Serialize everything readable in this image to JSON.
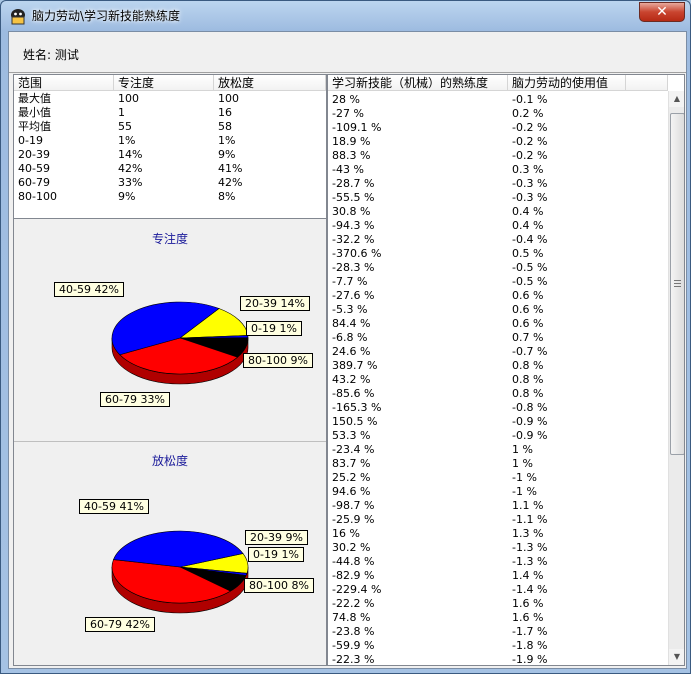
{
  "window": {
    "title": "脑力劳动\\学习新技能熟练度",
    "close": "✕"
  },
  "name_label": "姓名: 测试",
  "stats": {
    "headers": [
      "范围",
      "专注度",
      "放松度"
    ],
    "rows": [
      [
        "最大值",
        "100",
        "100"
      ],
      [
        "最小值",
        "1",
        "16"
      ],
      [
        "平均值",
        "55",
        "58"
      ],
      [
        "0-19",
        "1%",
        "1%"
      ],
      [
        "20-39",
        "14%",
        "9%"
      ],
      [
        "40-59",
        "42%",
        "41%"
      ],
      [
        "60-79",
        "33%",
        "42%"
      ],
      [
        "80-100",
        "9%",
        "8%"
      ]
    ]
  },
  "chart_data": [
    {
      "type": "pie",
      "title": "专注度",
      "slices": [
        {
          "label": "0-19",
          "value": 1,
          "text": "0-19  1%",
          "color": "#0000ff"
        },
        {
          "label": "20-39",
          "value": 14,
          "text": "20-39  14%",
          "color": "#ffff00"
        },
        {
          "label": "40-59",
          "value": 42,
          "text": "40-59  42%",
          "color": "#0000ff"
        },
        {
          "label": "60-79",
          "value": 33,
          "text": "60-79  33%",
          "color": "#ff0000"
        },
        {
          "label": "80-100",
          "value": 9,
          "text": "80-100  9%",
          "color": "#000000"
        }
      ]
    },
    {
      "type": "pie",
      "title": "放松度",
      "slices": [
        {
          "label": "0-19",
          "value": 1,
          "text": "0-19  1%",
          "color": "#0000ff"
        },
        {
          "label": "20-39",
          "value": 9,
          "text": "20-39  9%",
          "color": "#ffff00"
        },
        {
          "label": "40-59",
          "value": 41,
          "text": "40-59  41%",
          "color": "#0000ff"
        },
        {
          "label": "60-79",
          "value": 42,
          "text": "60-79  42%",
          "color": "#ff0000"
        },
        {
          "label": "80-100",
          "value": 8,
          "text": "80-100  8%",
          "color": "#000000"
        }
      ]
    }
  ],
  "list": {
    "headers": [
      "学习新技能（机械）的熟练度",
      "脑力劳动的使用值"
    ],
    "rows": [
      [
        "28 %",
        "-0.1 %"
      ],
      [
        "-27 %",
        "0.2 %"
      ],
      [
        "-109.1 %",
        "-0.2 %"
      ],
      [
        "18.9 %",
        "-0.2 %"
      ],
      [
        "88.3 %",
        "-0.2 %"
      ],
      [
        "-43 %",
        "0.3 %"
      ],
      [
        "-28.7 %",
        "-0.3 %"
      ],
      [
        "-55.5 %",
        "-0.3 %"
      ],
      [
        "30.8 %",
        "0.4 %"
      ],
      [
        "-94.3 %",
        "0.4 %"
      ],
      [
        "-32.2 %",
        "-0.4 %"
      ],
      [
        "-370.6 %",
        "0.5 %"
      ],
      [
        "-28.3 %",
        "-0.5 %"
      ],
      [
        "-7.7 %",
        "-0.5 %"
      ],
      [
        "-27.6 %",
        "0.6 %"
      ],
      [
        "-5.3 %",
        "0.6 %"
      ],
      [
        "84.4 %",
        "0.6 %"
      ],
      [
        "-6.8 %",
        "0.7 %"
      ],
      [
        "24.6 %",
        "-0.7 %"
      ],
      [
        "389.7 %",
        "0.8 %"
      ],
      [
        "43.2 %",
        "0.8 %"
      ],
      [
        "-85.6 %",
        "0.8 %"
      ],
      [
        "-165.3 %",
        "-0.8 %"
      ],
      [
        "150.5 %",
        "-0.9 %"
      ],
      [
        "53.3 %",
        "-0.9 %"
      ],
      [
        "-23.4 %",
        "1 %"
      ],
      [
        "83.7 %",
        "1 %"
      ],
      [
        "25.2 %",
        "-1 %"
      ],
      [
        "94.6 %",
        "-1 %"
      ],
      [
        "-98.7 %",
        "1.1 %"
      ],
      [
        "-25.9 %",
        "-1.1 %"
      ],
      [
        "16 %",
        "1.3 %"
      ],
      [
        "30.2 %",
        "-1.3 %"
      ],
      [
        "-44.8 %",
        "-1.3 %"
      ],
      [
        "-82.9 %",
        "1.4 %"
      ],
      [
        "-229.4 %",
        "-1.4 %"
      ],
      [
        "-22.2 %",
        "1.6 %"
      ],
      [
        "74.8 %",
        "1.6 %"
      ],
      [
        "-23.8 %",
        "-1.7 %"
      ],
      [
        "-59.9 %",
        "-1.8 %"
      ],
      [
        "-22.3 %",
        "-1.9 %"
      ]
    ]
  }
}
